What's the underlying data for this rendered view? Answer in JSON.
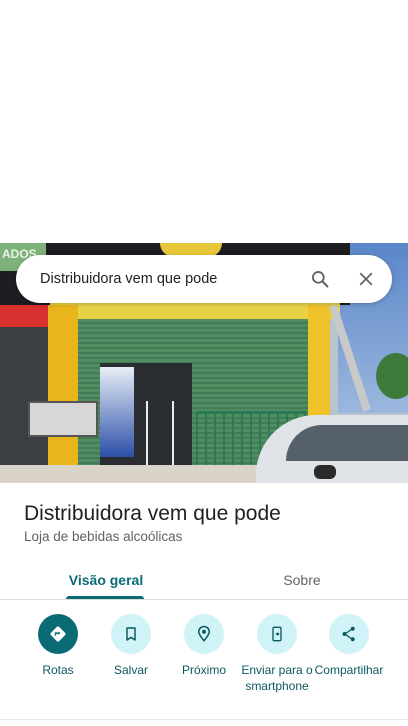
{
  "search": {
    "query": "Distribuidora vem que pode"
  },
  "photo": {
    "sign_text": "ADOS"
  },
  "place": {
    "title": "Distribuidora vem que pode",
    "category": "Loja de bebidas alcoólicas"
  },
  "tabs": [
    {
      "label": "Visão geral",
      "selected": true
    },
    {
      "label": "Sobre",
      "selected": false
    }
  ],
  "actions": [
    {
      "label": "Rotas",
      "icon": "directions-icon"
    },
    {
      "label": "Salvar",
      "icon": "bookmark-icon"
    },
    {
      "label": "Próximo",
      "icon": "nearby-icon"
    },
    {
      "label": "Enviar para o smartphone",
      "icon": "send-to-phone-icon"
    },
    {
      "label": "Compartilhar",
      "icon": "share-icon"
    }
  ],
  "colors": {
    "accent": "#0b6b74",
    "action_bg": "#cff3f7",
    "text_primary": "#202124",
    "text_secondary": "#5f6368"
  }
}
